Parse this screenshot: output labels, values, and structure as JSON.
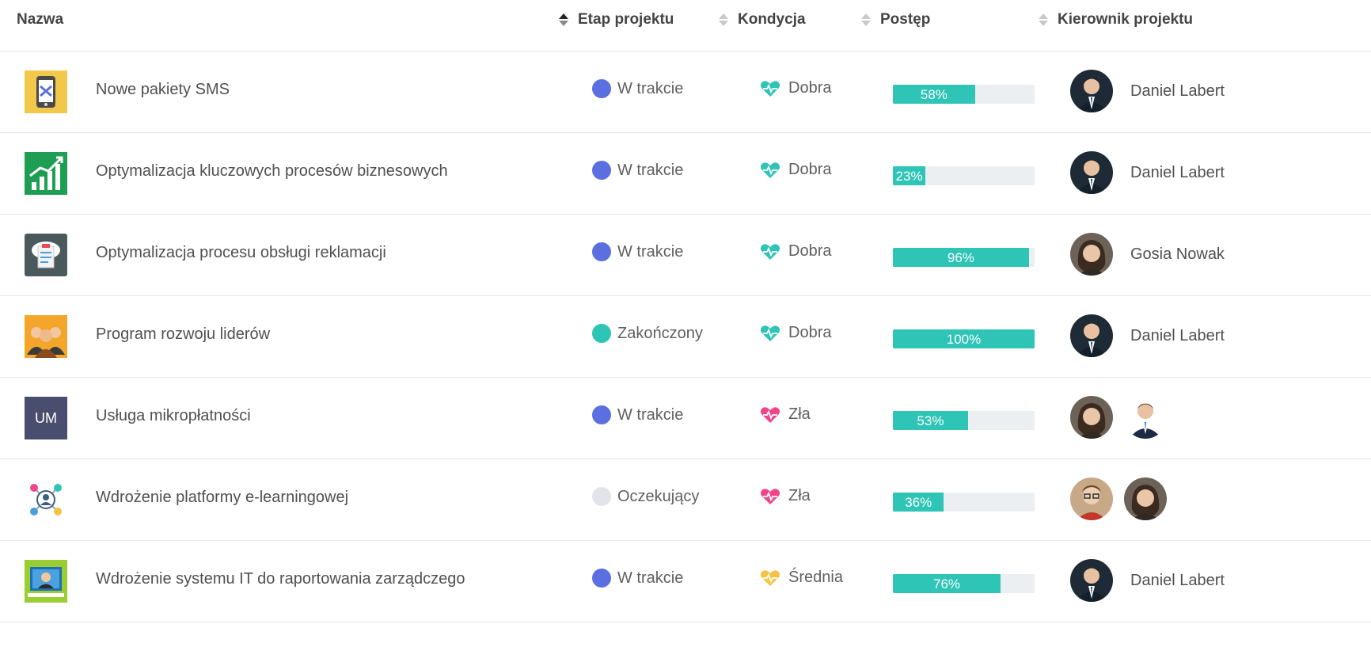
{
  "columns": {
    "name": "Nazwa",
    "stage": "Etap projektu",
    "condition": "Kondycja",
    "progress": "Postęp",
    "manager": "Kierownik projektu"
  },
  "sort": {
    "active_column": "stage",
    "direction": "asc"
  },
  "colors": {
    "in_progress": "#5b6fe0",
    "completed": "#2ec4b6",
    "pending": "#e3e4ea",
    "good": "#2ec4b6",
    "bad": "#f0458a",
    "medium": "#f5c242",
    "progress_fill": "#2ec4b6"
  },
  "rows": [
    {
      "icon": "sms-phone-icon",
      "name": "Nowe pakiety SMS",
      "stage": "W trakcie",
      "condition": "Dobra",
      "progress": 58,
      "progress_label": "58%",
      "managers": [
        "man-suit"
      ],
      "manager_name": "Daniel Labert"
    },
    {
      "icon": "growth-chart-icon",
      "name": "Optymalizacja kluczowych procesów biznesowych",
      "stage": "W trakcie",
      "condition": "Dobra",
      "progress": 23,
      "progress_label": "23%",
      "managers": [
        "man-suit"
      ],
      "manager_name": "Daniel Labert"
    },
    {
      "icon": "cloud-clipboard-icon",
      "name": "Optymalizacja procesu obsługi reklamacji",
      "stage": "W trakcie",
      "condition": "Dobra",
      "progress": 96,
      "progress_label": "96%",
      "managers": [
        "woman"
      ],
      "manager_name": "Gosia Nowak"
    },
    {
      "icon": "team-people-icon",
      "name": "Program rozwoju liderów",
      "stage": "Zakończony",
      "condition": "Dobra",
      "progress": 100,
      "progress_label": "100%",
      "managers": [
        "man-suit"
      ],
      "manager_name": "Daniel Labert"
    },
    {
      "icon": "um-initials-icon",
      "icon_text": "UM",
      "name": "Usługa mikropłatności",
      "stage": "W trakcie",
      "condition": "Zła",
      "progress": 53,
      "progress_label": "53%",
      "managers": [
        "woman",
        "man-tie"
      ],
      "manager_name": ""
    },
    {
      "icon": "network-nodes-icon",
      "name": "Wdrożenie platformy e-learningowej",
      "stage": "Oczekujący",
      "condition": "Zła",
      "progress": 36,
      "progress_label": "36%",
      "managers": [
        "man-glasses",
        "woman"
      ],
      "manager_name": ""
    },
    {
      "icon": "presenter-screen-icon",
      "name": "Wdrożenie systemu IT do raportowania zarządczego",
      "stage": "W trakcie",
      "condition": "Średnia",
      "progress": 76,
      "progress_label": "76%",
      "managers": [
        "man-suit"
      ],
      "manager_name": "Daniel Labert"
    }
  ]
}
